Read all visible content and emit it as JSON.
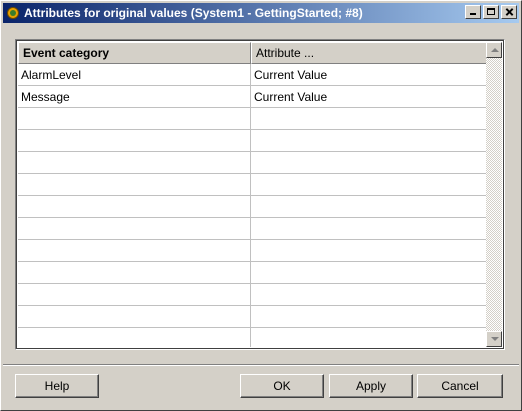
{
  "window": {
    "title": "Attributes for original values (System1 - GettingStarted; #8)"
  },
  "grid": {
    "columns": [
      "Event category",
      "Attribute ..."
    ],
    "rows": [
      [
        "AlarmLevel",
        "Current Value"
      ],
      [
        "Message",
        "Current Value"
      ],
      [
        "",
        ""
      ],
      [
        "",
        ""
      ],
      [
        "",
        ""
      ],
      [
        "",
        ""
      ],
      [
        "",
        ""
      ],
      [
        "",
        ""
      ],
      [
        "",
        ""
      ],
      [
        "",
        ""
      ],
      [
        "",
        ""
      ],
      [
        "",
        ""
      ],
      [
        "",
        ""
      ]
    ]
  },
  "buttons": {
    "help": "Help",
    "ok": "OK",
    "apply": "Apply",
    "cancel": "Cancel"
  },
  "icons": {
    "app": "gear-icon",
    "minimize": "minimize-icon",
    "maximize": "maximize-icon",
    "close": "close-icon",
    "scroll_up": "arrow-up-icon",
    "scroll_down": "arrow-down-icon"
  }
}
